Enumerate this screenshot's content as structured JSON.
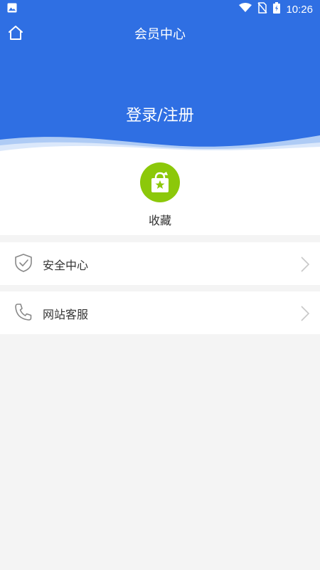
{
  "status_bar": {
    "time": "10:26",
    "icons": [
      "image-icon",
      "wifi-icon",
      "no-sim-icon",
      "battery-charging-icon"
    ]
  },
  "header": {
    "title": "会员中心",
    "home_icon": "home-icon",
    "login_label": "登录/注册",
    "color": "#2f6fe3"
  },
  "favorites": {
    "label": "收藏",
    "icon": "shopping-bag-star-icon",
    "color": "#8cc80a"
  },
  "menu": [
    {
      "label": "安全中心",
      "icon": "shield-check-icon"
    },
    {
      "label": "网站客服",
      "icon": "phone-icon"
    }
  ]
}
